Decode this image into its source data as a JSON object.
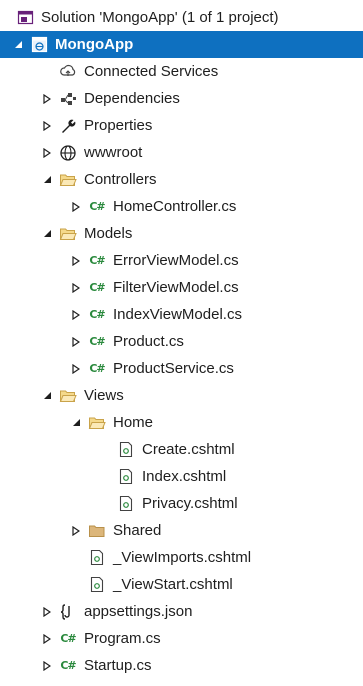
{
  "solution_explorer": {
    "solution_label": "Solution 'MongoApp' (1 of 1 project)",
    "nodes": [
      {
        "label": "MongoApp",
        "icon": "web-project-icon",
        "expander": "expanded",
        "depth": 0,
        "selected": true
      },
      {
        "label": "Connected Services",
        "icon": "connected-services-icon",
        "expander": "none",
        "depth": 1
      },
      {
        "label": "Dependencies",
        "icon": "dependencies-icon",
        "expander": "collapsed",
        "depth": 1
      },
      {
        "label": "Properties",
        "icon": "wrench-icon",
        "expander": "collapsed",
        "depth": 1
      },
      {
        "label": "wwwroot",
        "icon": "globe-icon",
        "expander": "collapsed",
        "depth": 1
      },
      {
        "label": "Controllers",
        "icon": "folder-open-icon",
        "expander": "expanded",
        "depth": 1
      },
      {
        "label": "HomeController.cs",
        "icon": "csharp-file-icon",
        "expander": "collapsed",
        "depth": 2
      },
      {
        "label": "Models",
        "icon": "folder-open-icon",
        "expander": "expanded",
        "depth": 1
      },
      {
        "label": "ErrorViewModel.cs",
        "icon": "csharp-file-icon",
        "expander": "collapsed",
        "depth": 2
      },
      {
        "label": "FilterViewModel.cs",
        "icon": "csharp-file-icon",
        "expander": "collapsed",
        "depth": 2
      },
      {
        "label": "IndexViewModel.cs",
        "icon": "csharp-file-icon",
        "expander": "collapsed",
        "depth": 2
      },
      {
        "label": "Product.cs",
        "icon": "csharp-file-icon",
        "expander": "collapsed",
        "depth": 2
      },
      {
        "label": "ProductService.cs",
        "icon": "csharp-file-icon",
        "expander": "collapsed",
        "depth": 2
      },
      {
        "label": "Views",
        "icon": "folder-open-icon",
        "expander": "expanded",
        "depth": 1
      },
      {
        "label": "Home",
        "icon": "folder-open-icon",
        "expander": "expanded",
        "depth": 2
      },
      {
        "label": "Create.cshtml",
        "icon": "razor-file-icon",
        "expander": "none",
        "depth": 3
      },
      {
        "label": "Index.cshtml",
        "icon": "razor-file-icon",
        "expander": "none",
        "depth": 3
      },
      {
        "label": "Privacy.cshtml",
        "icon": "razor-file-icon",
        "expander": "none",
        "depth": 3
      },
      {
        "label": "Shared",
        "icon": "folder-closed-icon",
        "expander": "collapsed",
        "depth": 2
      },
      {
        "label": "_ViewImports.cshtml",
        "icon": "razor-file-icon",
        "expander": "none",
        "depth": 2
      },
      {
        "label": "_ViewStart.cshtml",
        "icon": "razor-file-icon",
        "expander": "none",
        "depth": 2
      },
      {
        "label": "appsettings.json",
        "icon": "json-file-icon",
        "expander": "collapsed",
        "depth": 1
      },
      {
        "label": "Program.cs",
        "icon": "csharp-file-icon",
        "expander": "collapsed",
        "depth": 1
      },
      {
        "label": "Startup.cs",
        "icon": "csharp-file-icon",
        "expander": "collapsed",
        "depth": 1
      }
    ]
  }
}
